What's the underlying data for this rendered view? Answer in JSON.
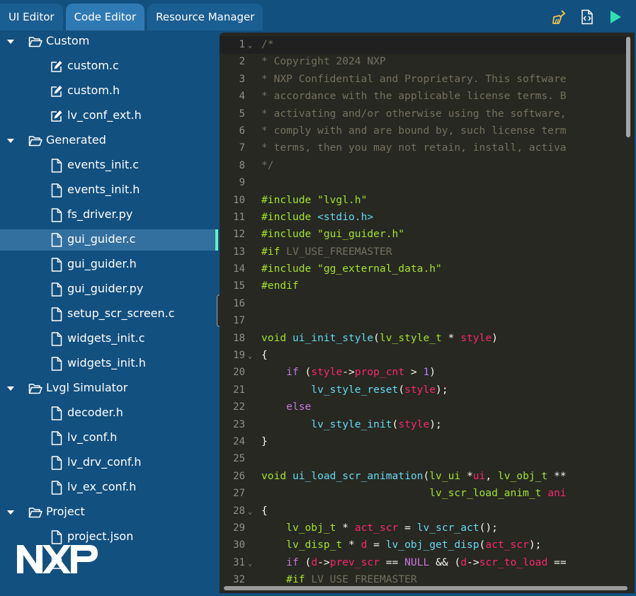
{
  "tabs": [
    "UI Editor",
    "Code Editor",
    "Resource Manager"
  ],
  "toolbar": {
    "clean_icon": "broom-icon",
    "export_icon": "code-file-icon",
    "run_icon": "play-icon",
    "run_color": "#2ee0b0"
  },
  "tree": [
    {
      "type": "folder",
      "label": "Custom"
    },
    {
      "type": "file",
      "label": "custom.c",
      "icon": "edit-icon"
    },
    {
      "type": "file",
      "label": "custom.h",
      "icon": "edit-icon"
    },
    {
      "type": "file",
      "label": "lv_conf_ext.h",
      "icon": "edit-icon"
    },
    {
      "type": "folder",
      "label": "Generated"
    },
    {
      "type": "file",
      "label": "events_init.c",
      "icon": "file-icon"
    },
    {
      "type": "file",
      "label": "events_init.h",
      "icon": "file-icon"
    },
    {
      "type": "file",
      "label": "fs_driver.py",
      "icon": "file-icon"
    },
    {
      "type": "file",
      "label": "gui_guider.c",
      "icon": "file-icon",
      "selected": true
    },
    {
      "type": "file",
      "label": "gui_guider.h",
      "icon": "file-icon"
    },
    {
      "type": "file",
      "label": "gui_guider.py",
      "icon": "file-icon"
    },
    {
      "type": "file",
      "label": "setup_scr_screen.c",
      "icon": "file-icon"
    },
    {
      "type": "file",
      "label": "widgets_init.c",
      "icon": "file-icon"
    },
    {
      "type": "file",
      "label": "widgets_init.h",
      "icon": "file-icon"
    },
    {
      "type": "folder",
      "label": "Lvgl Simulator"
    },
    {
      "type": "file",
      "label": "decoder.h",
      "icon": "file-icon"
    },
    {
      "type": "file",
      "label": "lv_conf.h",
      "icon": "file-icon"
    },
    {
      "type": "file",
      "label": "lv_drv_conf.h",
      "icon": "file-icon"
    },
    {
      "type": "file",
      "label": "lv_ex_conf.h",
      "icon": "file-icon"
    },
    {
      "type": "folder",
      "label": "Project"
    },
    {
      "type": "file",
      "label": "project.json",
      "icon": "file-icon"
    },
    {
      "type": "file",
      "label": "",
      "icon": "file-icon",
      "partial": true
    }
  ],
  "brand": {
    "logo": "NXP",
    "logo_icon": "nxp-logo-icon"
  },
  "collapse_icon": "chevron-left-icon",
  "code_colors": {
    "plain": "#f8f8f2",
    "comment": "#75715e",
    "preproc": "#a6e22e",
    "string": "#a6e22e",
    "system_header": "#66d9ef",
    "type": "#a6e22e",
    "function": "#66d9ef",
    "keyword": "#c678dd",
    "param": "#f92672",
    "number": "#ae81ff",
    "punct": "#f8f8f2"
  },
  "code": [
    {
      "n": 1,
      "fold": true,
      "t": [
        [
          "comment",
          "/*"
        ]
      ]
    },
    {
      "n": 2,
      "t": [
        [
          "comment",
          "* Copyright 2024 NXP"
        ]
      ]
    },
    {
      "n": 3,
      "t": [
        [
          "comment",
          "* NXP Confidential and Proprietary. This software"
        ]
      ]
    },
    {
      "n": 4,
      "t": [
        [
          "comment",
          "* accordance with the applicable license terms. B"
        ]
      ]
    },
    {
      "n": 5,
      "t": [
        [
          "comment",
          "* activating and/or otherwise using the software,"
        ]
      ]
    },
    {
      "n": 6,
      "t": [
        [
          "comment",
          "* comply with and are bound by, such license term"
        ]
      ]
    },
    {
      "n": 7,
      "t": [
        [
          "comment",
          "* terms, then you may not retain, install, activa"
        ]
      ]
    },
    {
      "n": 8,
      "t": [
        [
          "comment",
          "*/"
        ]
      ]
    },
    {
      "n": 9,
      "t": []
    },
    {
      "n": 10,
      "t": [
        [
          "preproc",
          "#include "
        ],
        [
          "string",
          "\"lvgl.h\""
        ]
      ]
    },
    {
      "n": 11,
      "t": [
        [
          "preproc",
          "#include "
        ],
        [
          "system_header",
          "<stdio.h>"
        ]
      ]
    },
    {
      "n": 12,
      "t": [
        [
          "preproc",
          "#include "
        ],
        [
          "string",
          "\"gui_guider.h\""
        ]
      ]
    },
    {
      "n": 13,
      "t": [
        [
          "preproc",
          "#if "
        ],
        [
          "comment",
          "LV_USE_FREEMASTER"
        ]
      ]
    },
    {
      "n": 14,
      "t": [
        [
          "preproc",
          "#include "
        ],
        [
          "string",
          "\"gg_external_data.h\""
        ]
      ]
    },
    {
      "n": 15,
      "t": [
        [
          "preproc",
          "#endif"
        ]
      ]
    },
    {
      "n": 16,
      "t": []
    },
    {
      "n": 17,
      "t": []
    },
    {
      "n": 18,
      "t": [
        [
          "type",
          "void "
        ],
        [
          "function",
          "ui_init_style"
        ],
        [
          "punct",
          "("
        ],
        [
          "type",
          "lv_style_t"
        ],
        [
          "punct",
          " * "
        ],
        [
          "param",
          "style"
        ],
        [
          "punct",
          ")"
        ]
      ]
    },
    {
      "n": 19,
      "fold": true,
      "t": [
        [
          "punct",
          "{"
        ]
      ]
    },
    {
      "n": 20,
      "t": [
        [
          "punct",
          "    "
        ],
        [
          "keyword",
          "if "
        ],
        [
          "punct",
          "("
        ],
        [
          "param",
          "style"
        ],
        [
          "punct",
          "->"
        ],
        [
          "param",
          "prop_cnt"
        ],
        [
          "punct",
          " > "
        ],
        [
          "number",
          "1"
        ],
        [
          "punct",
          ")"
        ]
      ]
    },
    {
      "n": 21,
      "t": [
        [
          "punct",
          "        "
        ],
        [
          "function",
          "lv_style_reset"
        ],
        [
          "punct",
          "("
        ],
        [
          "param",
          "style"
        ],
        [
          "punct",
          ");"
        ]
      ]
    },
    {
      "n": 22,
      "t": [
        [
          "punct",
          "    "
        ],
        [
          "keyword",
          "else"
        ]
      ]
    },
    {
      "n": 23,
      "t": [
        [
          "punct",
          "        "
        ],
        [
          "function",
          "lv_style_init"
        ],
        [
          "punct",
          "("
        ],
        [
          "param",
          "style"
        ],
        [
          "punct",
          ");"
        ]
      ]
    },
    {
      "n": 24,
      "t": [
        [
          "punct",
          "}"
        ]
      ]
    },
    {
      "n": 25,
      "t": []
    },
    {
      "n": 26,
      "t": [
        [
          "type",
          "void "
        ],
        [
          "function",
          "ui_load_scr_animation"
        ],
        [
          "punct",
          "("
        ],
        [
          "type",
          "lv_ui"
        ],
        [
          "punct",
          " *"
        ],
        [
          "param",
          "ui"
        ],
        [
          "punct",
          ", "
        ],
        [
          "type",
          "lv_obj_t"
        ],
        [
          "punct",
          " **"
        ]
      ]
    },
    {
      "n": 27,
      "t": [
        [
          "punct",
          "                           "
        ],
        [
          "type",
          "lv_scr_load_anim_t"
        ],
        [
          "punct",
          " "
        ],
        [
          "param",
          "ani"
        ]
      ]
    },
    {
      "n": 28,
      "fold": true,
      "t": [
        [
          "punct",
          "{"
        ]
      ]
    },
    {
      "n": 29,
      "t": [
        [
          "punct",
          "    "
        ],
        [
          "type",
          "lv_obj_t"
        ],
        [
          "punct",
          " * "
        ],
        [
          "param",
          "act_scr"
        ],
        [
          "punct",
          " = "
        ],
        [
          "function",
          "lv_scr_act"
        ],
        [
          "punct",
          "();"
        ]
      ]
    },
    {
      "n": 30,
      "t": [
        [
          "punct",
          "    "
        ],
        [
          "type",
          "lv_disp_t"
        ],
        [
          "punct",
          " * "
        ],
        [
          "param",
          "d"
        ],
        [
          "punct",
          " = "
        ],
        [
          "function",
          "lv_obj_get_disp"
        ],
        [
          "punct",
          "("
        ],
        [
          "param",
          "act_scr"
        ],
        [
          "punct",
          ");"
        ]
      ]
    },
    {
      "n": 31,
      "fold": true,
      "t": [
        [
          "punct",
          "    "
        ],
        [
          "keyword",
          "if "
        ],
        [
          "punct",
          "("
        ],
        [
          "param",
          "d"
        ],
        [
          "punct",
          "->"
        ],
        [
          "param",
          "prev_scr"
        ],
        [
          "punct",
          " == "
        ],
        [
          "keyword",
          "NULL"
        ],
        [
          "punct",
          " && ("
        ],
        [
          "param",
          "d"
        ],
        [
          "punct",
          "->"
        ],
        [
          "param",
          "scr_to_load"
        ],
        [
          "punct",
          " =="
        ]
      ]
    },
    {
      "n": 32,
      "t": [
        [
          "punct",
          "    "
        ],
        [
          "preproc",
          "#if "
        ],
        [
          "comment",
          "LV_USE_FREEMASTER"
        ]
      ]
    }
  ]
}
